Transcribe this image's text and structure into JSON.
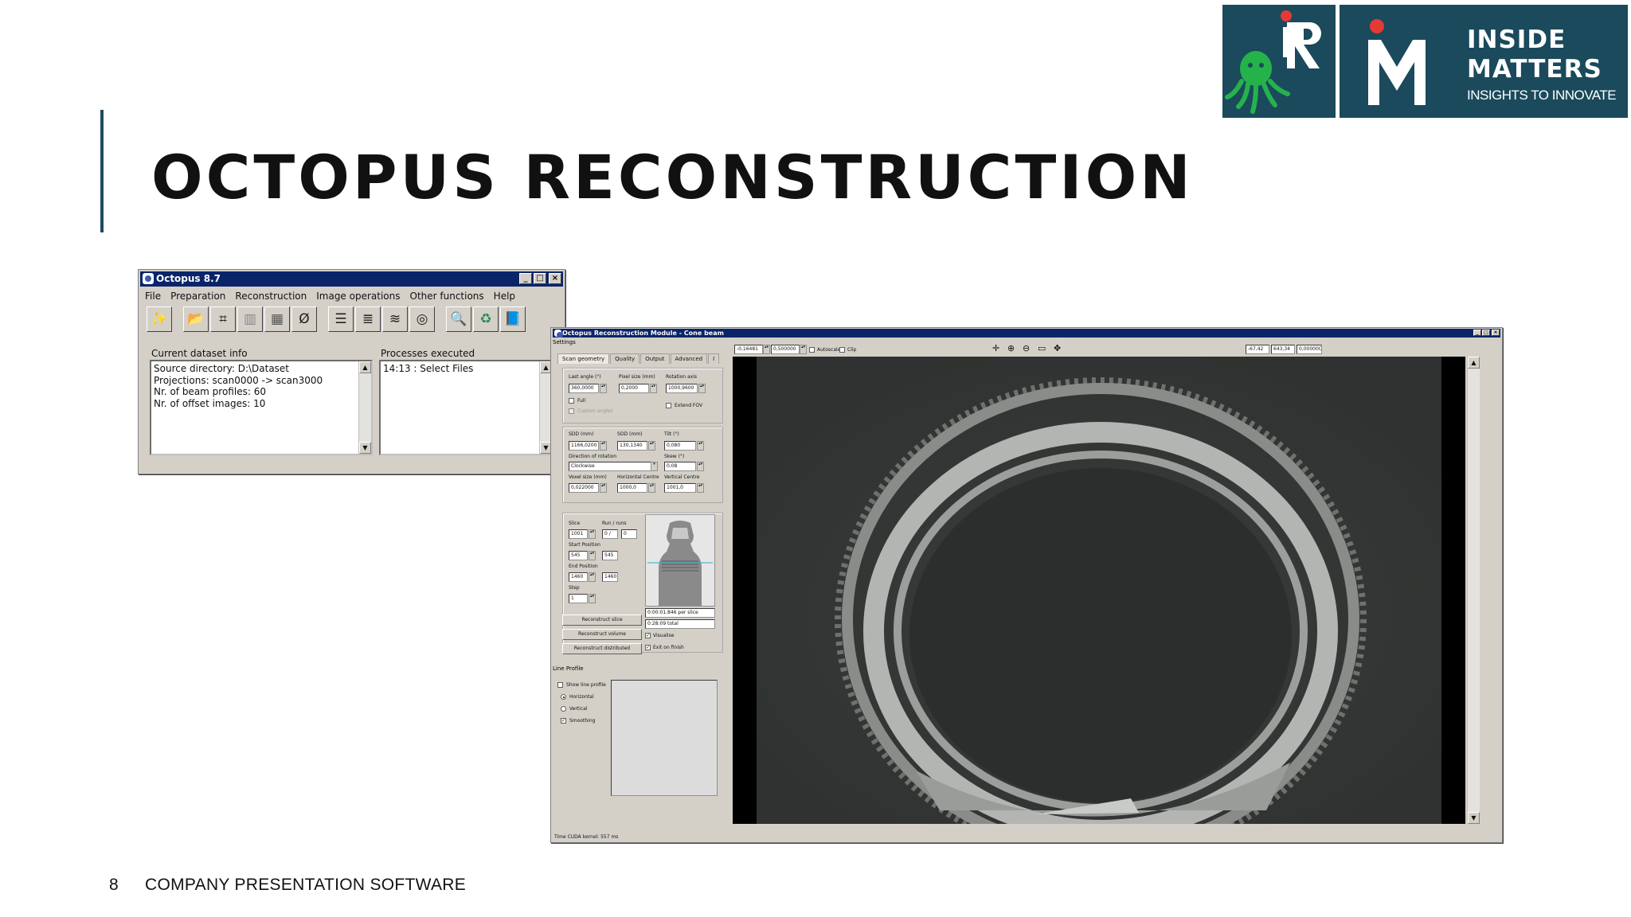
{
  "slide": {
    "title": "OCTOPUS RECONSTRUCTION",
    "page_number": "8",
    "footer": "COMPANY PRESENTATION SOFTWARE",
    "accent_color": "#1f4a63"
  },
  "logos": {
    "ir_letters": "iR",
    "im_letters": "iM",
    "brand_line1": "INSIDE",
    "brand_line2": "MATTERS",
    "tagline": "INSIGHTS TO INNOVATE",
    "brand_color": "#1a4a5c",
    "octopus_color": "#26b24b",
    "dot_color": "#e53935"
  },
  "main_window": {
    "title": "Octopus 8.7",
    "menu": [
      "File",
      "Preparation",
      "Reconstruction",
      "Image operations",
      "Other functions",
      "Help"
    ],
    "toolbar_icons": [
      "wizard-icon",
      "open-folder-icon",
      "crop-icon",
      "flat-field-icon",
      "normalize-icon",
      "filter-icon",
      "stack-icon",
      "stack-2-icon",
      "stack-3-icon",
      "ring-icon",
      "zoom-search-icon",
      "recycle-icon",
      "help-book-icon"
    ],
    "dataset_label": "Current dataset info",
    "dataset_lines": [
      "Source directory: D:\\Dataset",
      "Projections: scan0000 -> scan3000",
      "Nr. of beam profiles: 60",
      "Nr. of offset images: 10"
    ],
    "processes_label": "Processes executed",
    "processes_lines": [
      "14:13 : Select Files"
    ]
  },
  "recon_window": {
    "title": "Octopus Reconstruction Module - Cone beam",
    "settings_label": "Settings",
    "tabs": [
      "Scan geometry",
      "Quality",
      "Output",
      "Advanced",
      "I"
    ],
    "last_angle_label": "Last angle (°)",
    "last_angle": "360,0000",
    "pixel_size_label": "Pixel size (mm)",
    "pixel_size": "0,2000",
    "rotation_axis_label": "Rotation axis",
    "rotation_axis": "1000,9600",
    "full_label": "Full",
    "custom_angles_label": "Custom angles",
    "extend_fov_label": "Extend FOV",
    "sdd_label": "SDD (mm)",
    "sdd": "1166,0200",
    "sod_label": "SOD (mm)",
    "sod": "130,1340",
    "tilt_label": "Tilt (°)",
    "tilt": "0,080",
    "direction_label": "Direction of rotation",
    "direction": "Clockwise",
    "skew_label": "Skew (°)",
    "skew": "0,08",
    "voxel_label": "Voxel size (mm)",
    "voxel": "0,022000",
    "hcentre_label": "Horizontal Centre",
    "hcentre": "1000,0",
    "vcentre_label": "Vertical Centre",
    "vcentre": "1001,0",
    "slice_label": "Slice",
    "slice": "1001",
    "run_label": "Run / runs",
    "run": "0 /",
    "runs": "0",
    "start_label": "Start Position",
    "start": "545",
    "start2": "545",
    "end_label": "End Position",
    "end": "1460",
    "end2": "1460",
    "step_label": "Step",
    "step": "1",
    "time_per_slice": "0:00:01.846 per slice",
    "time_total": "0:28:09 total",
    "btn_slice": "Reconstruct slice",
    "btn_volume": "Reconstruct volume",
    "btn_distributed": "Reconstruct distributed",
    "visualise_label": "Visualise",
    "exit_label": "Exit on finish",
    "line_profile_label": "Line Profile",
    "show_line_label": "Show line profile",
    "horizontal_label": "Horizontal",
    "vertical_label": "Vertical",
    "smoothing_label": "Smoothing",
    "status": "Time CUDA kernel: 557 ms",
    "min_value": "-0,16481",
    "max_value": "0,500000",
    "autoscale_label": "Autoscale",
    "clip_label": "Clip",
    "coord_x": "-67,42",
    "coord_y": "643,34",
    "coord_v": "0,00000C"
  }
}
